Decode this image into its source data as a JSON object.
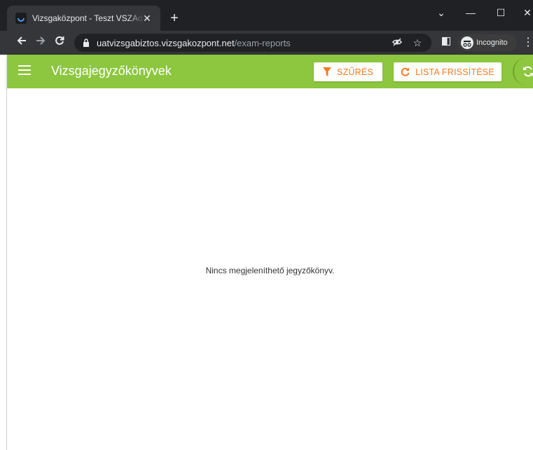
{
  "browser": {
    "tab_title": "Vizsgaközpont - Teszt VSZAdmin",
    "tab_close": "✕",
    "new_tab": "+",
    "url_host": "uatvizsgabiztos.vizsgakozpont.net",
    "url_path": "/exam-reports",
    "incognito_label": "Incognito",
    "window_controls": {
      "minimize": "—",
      "maximize": "☐",
      "close": "✕",
      "tab_search": "⌄"
    }
  },
  "appbar": {
    "title": "Vizsgajegyzőkönyvek",
    "filter_label": "SZŰRÉS",
    "refresh_label": "LISTA FRISSÍTÉSE",
    "background_color": "#8dc63f",
    "accent_color": "#f47b20"
  },
  "content": {
    "empty_message": "Nincs megjeleníthető jegyzőkönyv."
  },
  "icons": [
    "back-arrow-icon",
    "forward-arrow-icon",
    "reload-icon",
    "lock-icon",
    "eye-off-icon",
    "star-icon",
    "sidepanel-icon",
    "incognito-icon",
    "menu-icon",
    "filter-icon",
    "refresh-icon",
    "sync-icon"
  ]
}
